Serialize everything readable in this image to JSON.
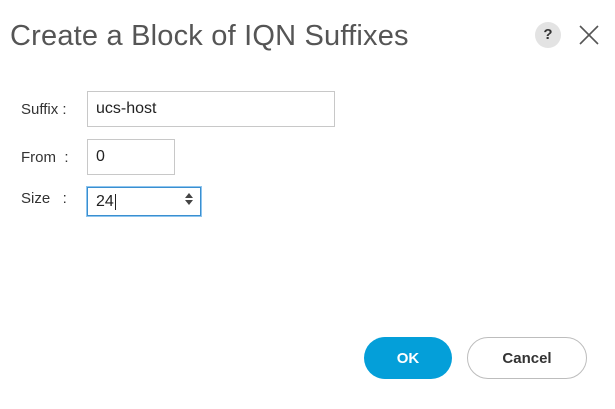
{
  "dialog": {
    "title": "Create a Block of IQN Suffixes",
    "help_icon_text": "?"
  },
  "fields": {
    "suffix": {
      "label": "Suffix :",
      "value": "ucs-host"
    },
    "from": {
      "label": "From  :",
      "value": "0"
    },
    "size": {
      "label": "Size   :",
      "value": "24"
    }
  },
  "buttons": {
    "ok": "OK",
    "cancel": "Cancel"
  },
  "icons": {
    "help": "help-icon",
    "close": "close-icon",
    "spinner": "spinner-arrows-icon"
  },
  "colors": {
    "ok_button": "#049fd9",
    "focus_border": "#3a8fd0"
  }
}
